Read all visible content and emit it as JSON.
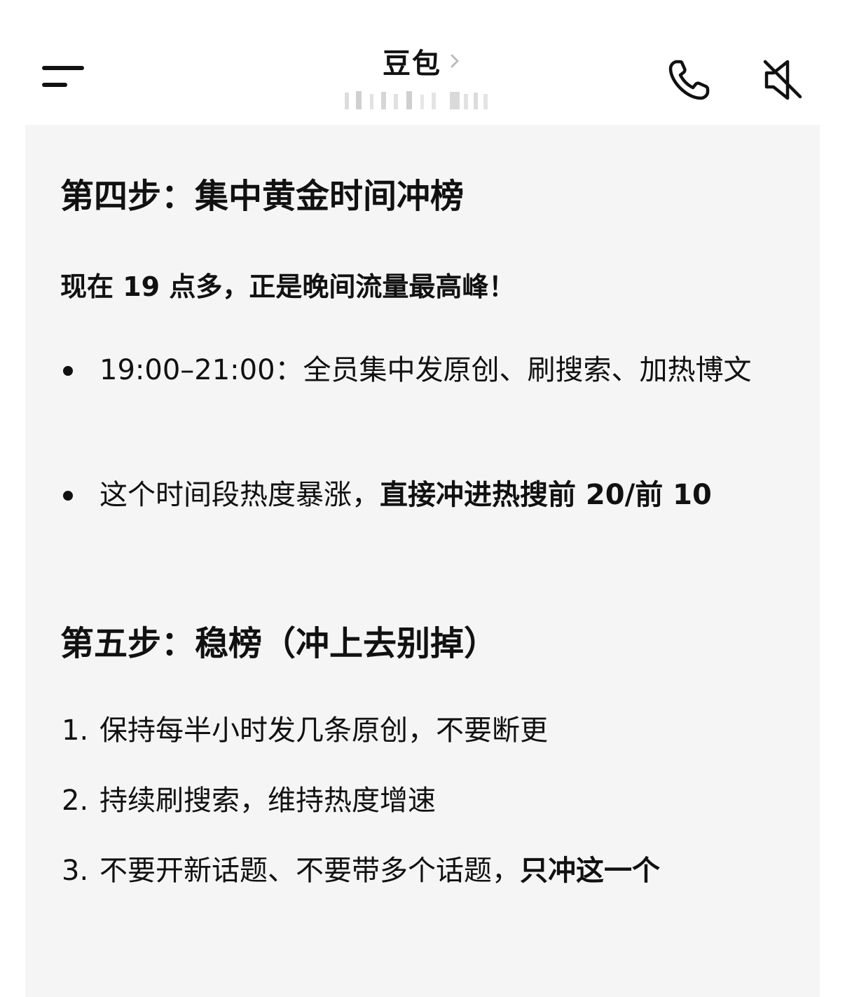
{
  "header": {
    "title": "豆包",
    "title_chevron": "›"
  },
  "sections": [
    {
      "heading": "第四步：集中黄金时间冲榜",
      "lead": "现在 19 点多，正是晚间流量最高峰！",
      "bullets": [
        {
          "text_plain": "19:00–21:00：全员集中发原创、刷搜索、加热博文",
          "text_bold": ""
        },
        {
          "text_plain": "这个时间段热度暴涨，",
          "text_bold": "直接冲进热搜前 20/前 10"
        }
      ]
    },
    {
      "heading": "第五步：稳榜（冲上去别掉）",
      "items": [
        {
          "num": "1.",
          "text_plain": "保持每半小时发几条原创，不要断更",
          "text_bold": ""
        },
        {
          "num": "2.",
          "text_plain": "持续刷搜索，维持热度增速",
          "text_bold": ""
        },
        {
          "num": "3.",
          "text_plain": "不要开新话题、不要带多个话题，",
          "text_bold": "只冲这一个"
        }
      ]
    }
  ],
  "icons": {
    "menu": "menu-icon",
    "phone": "phone-icon",
    "mute": "speaker-mute-icon"
  }
}
